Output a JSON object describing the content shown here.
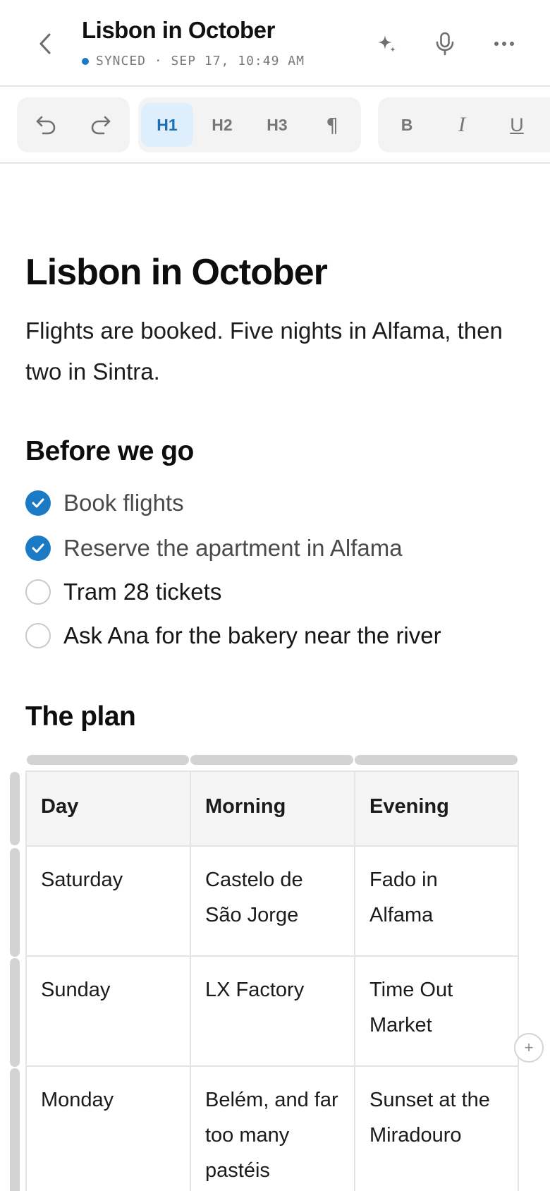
{
  "header": {
    "title": "Lisbon in October",
    "sync_status": "SYNCED · SEP 17, 10:49 AM",
    "accent_color": "#1a7ac4",
    "icons": [
      "chevron-left-icon",
      "sparkle-icon",
      "microphone-icon",
      "more-icon"
    ]
  },
  "toolbar": {
    "undo_icon": "undo-icon",
    "redo_icon": "redo-icon",
    "h1": "H1",
    "h2": "H2",
    "h3": "H3",
    "paragraph": "¶",
    "bold": "B",
    "italic": "I",
    "underline": "U",
    "active_block": "H1"
  },
  "document": {
    "title": "Lisbon in October",
    "intro": "Flights are booked. Five nights in Alfama, then two in Sintra.",
    "checklist_heading": "Before we go",
    "checklist": [
      {
        "label": "Book flights",
        "done": true
      },
      {
        "label": "Reserve the apartment in Alfama",
        "done": true
      },
      {
        "label": "Tram 28 tickets",
        "done": false
      },
      {
        "label": "Ask Ana for the bakery near the river",
        "done": false
      }
    ],
    "plan_heading": "The plan",
    "table": {
      "headers": [
        "Day",
        "Morning",
        "Evening"
      ],
      "rows": [
        [
          "Saturday",
          "Castelo de São Jorge",
          "Fado in Alfama"
        ],
        [
          "Sunday",
          "LX Factory",
          "Time Out Market"
        ],
        [
          "Monday",
          "Belém, and far too many pastéis",
          "Sunset at the Miradouro"
        ]
      ],
      "add_column_label": "+"
    }
  }
}
